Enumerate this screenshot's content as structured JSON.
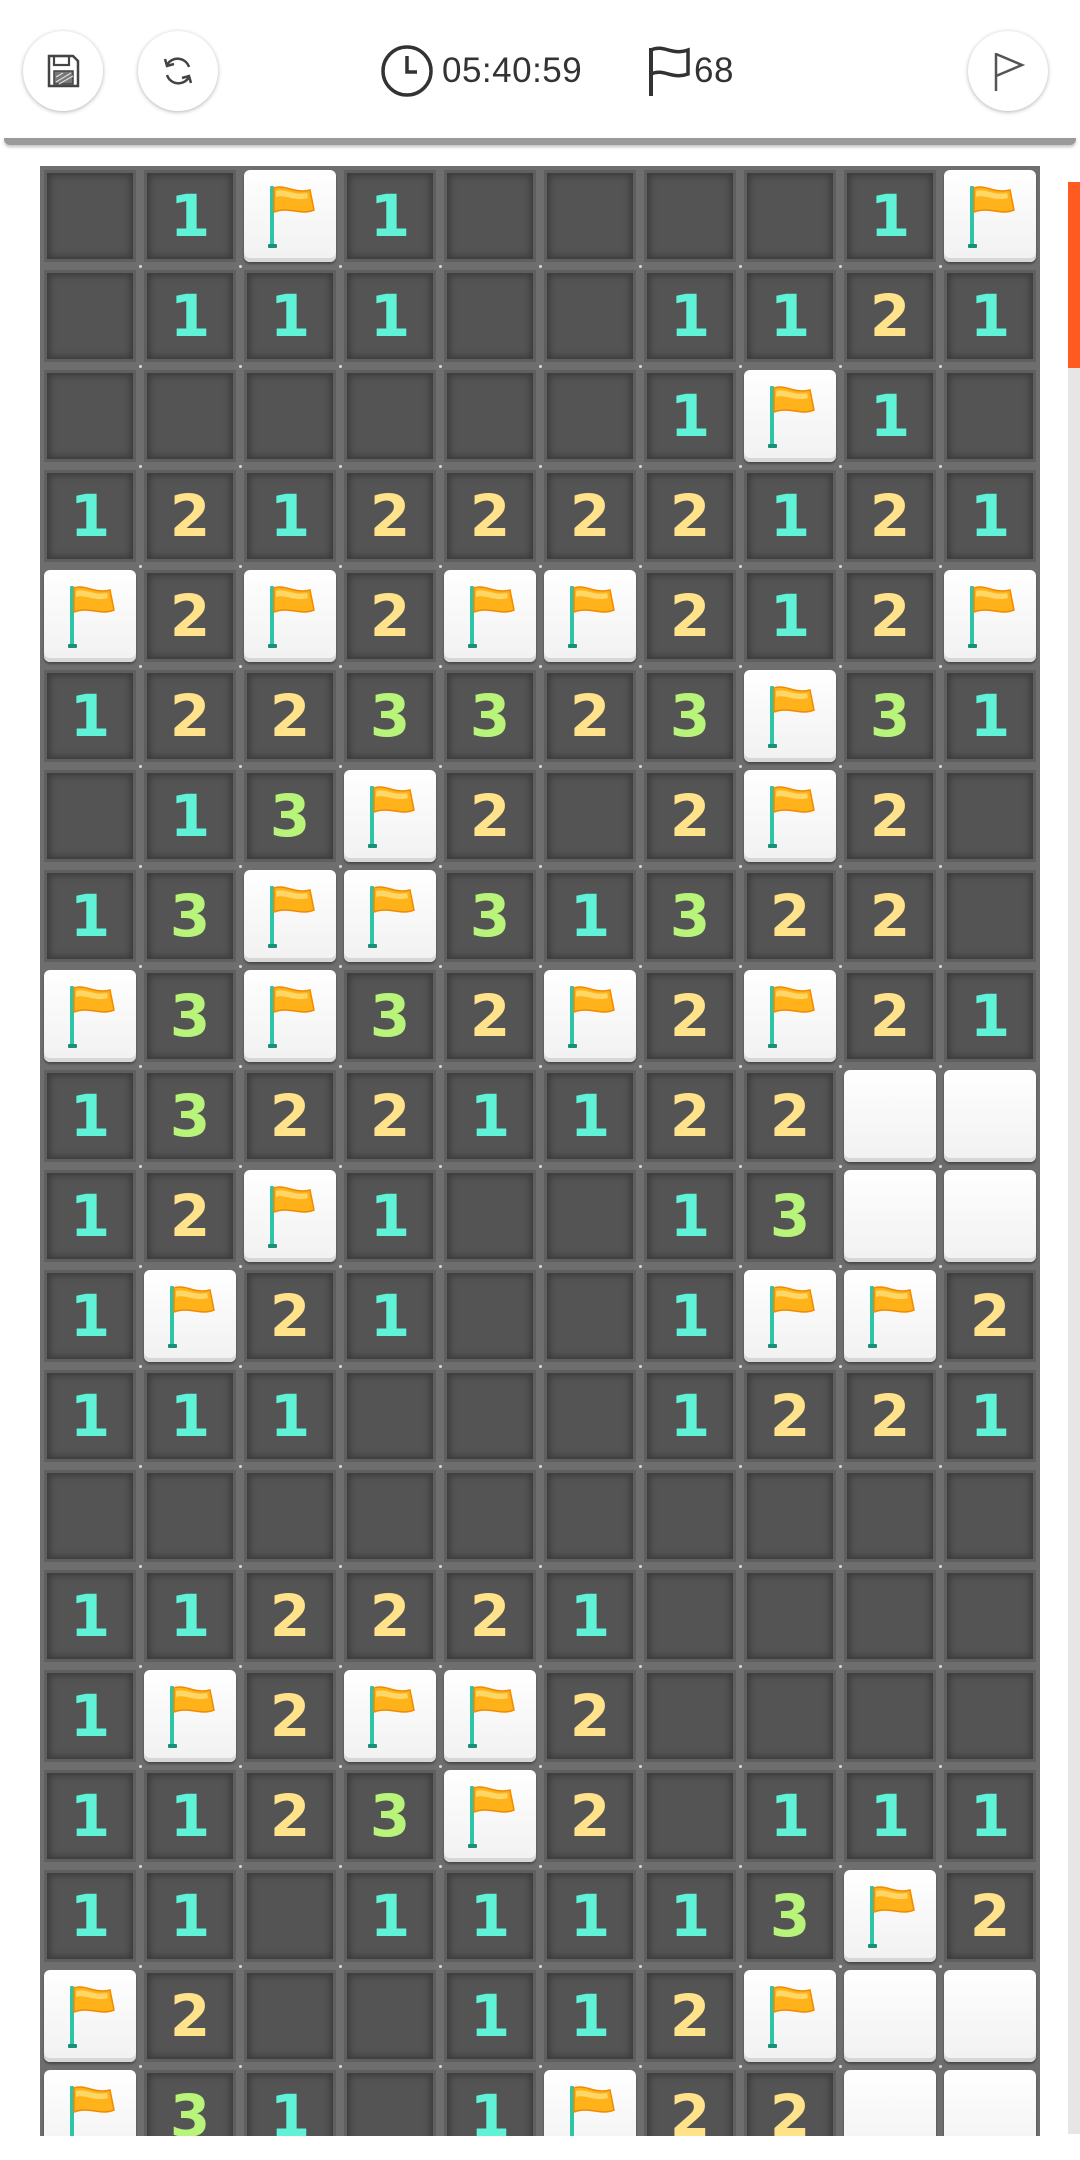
{
  "header": {
    "save_icon": "save-icon",
    "restart_icon": "restart-icon",
    "clock_icon": "clock-icon",
    "timer": "05:40:59",
    "flag_icon": "flag-icon",
    "flags_remaining": "68",
    "flag_mode_icon": "flag-mode-icon"
  },
  "colors": {
    "1": "#5ff2d6",
    "2": "#ffe28a",
    "3": "#b9f47a",
    "accent": "#ff5a1f"
  },
  "board": {
    "columns": 10,
    "legend": {
      "F": "flagged",
      "X": "unrevealed",
      ".": "revealed-empty",
      "1-3": "adjacent mine count"
    },
    "rows": [
      [
        ".",
        "1",
        "F",
        "1",
        ".",
        ".",
        ".",
        ".",
        "1",
        "F"
      ],
      [
        ".",
        "1",
        "1",
        "1",
        ".",
        ".",
        "1",
        "1",
        "2",
        "1"
      ],
      [
        ".",
        ".",
        ".",
        ".",
        ".",
        ".",
        "1",
        "F",
        "1",
        "."
      ],
      [
        "1",
        "2",
        "1",
        "2",
        "2",
        "2",
        "2",
        "1",
        "2",
        "1"
      ],
      [
        "F",
        "2",
        "F",
        "2",
        "F",
        "F",
        "2",
        "1",
        "2",
        "F"
      ],
      [
        "1",
        "2",
        "2",
        "3",
        "3",
        "2",
        "3",
        "F",
        "3",
        "1"
      ],
      [
        ".",
        "1",
        "3",
        "F",
        "2",
        ".",
        "2",
        "F",
        "2",
        "."
      ],
      [
        "1",
        "3",
        "F",
        "F",
        "3",
        "1",
        "3",
        "2",
        "2",
        "."
      ],
      [
        "F",
        "3",
        "F",
        "3",
        "2",
        "F",
        "2",
        "F",
        "2",
        "1"
      ],
      [
        "1",
        "3",
        "2",
        "2",
        "1",
        "1",
        "2",
        "2",
        "X",
        "X"
      ],
      [
        "1",
        "2",
        "F",
        "1",
        ".",
        ".",
        "1",
        "3",
        "X",
        "X"
      ],
      [
        "1",
        "F",
        "2",
        "1",
        ".",
        ".",
        "1",
        "F",
        "F",
        "2"
      ],
      [
        "1",
        "1",
        "1",
        ".",
        ".",
        ".",
        "1",
        "2",
        "2",
        "1"
      ],
      [
        ".",
        ".",
        ".",
        ".",
        ".",
        ".",
        ".",
        ".",
        ".",
        "."
      ],
      [
        "1",
        "1",
        "2",
        "2",
        "2",
        "1",
        ".",
        ".",
        ".",
        "."
      ],
      [
        "1",
        "F",
        "2",
        "F",
        "F",
        "2",
        ".",
        ".",
        ".",
        "."
      ],
      [
        "1",
        "1",
        "2",
        "3",
        "F",
        "2",
        ".",
        "1",
        "1",
        "1"
      ],
      [
        "1",
        "1",
        ".",
        "1",
        "1",
        "1",
        "1",
        "3",
        "F",
        "2"
      ],
      [
        "F",
        "2",
        ".",
        ".",
        "1",
        "1",
        "2",
        "F",
        "X",
        "X"
      ],
      [
        "F",
        "3",
        "1",
        ".",
        "1",
        "F",
        "2",
        "2",
        "X",
        "X"
      ]
    ]
  }
}
